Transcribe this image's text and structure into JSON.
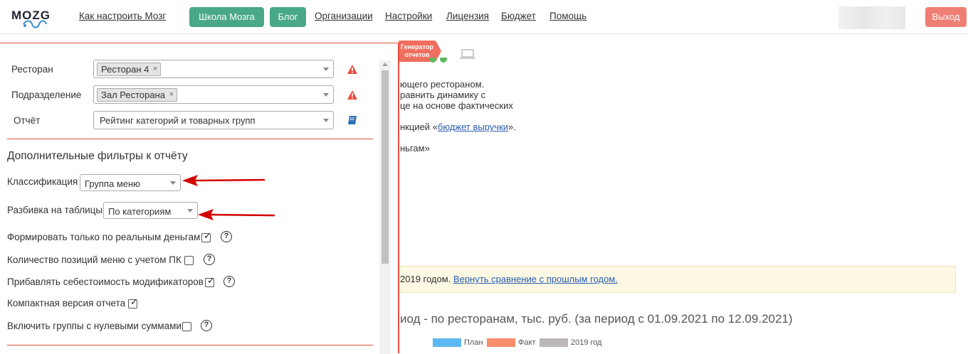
{
  "navbar": {
    "logo": "MOZG",
    "how_to": "Как настроить Мозг",
    "school_button": "Школа Мозга",
    "blog_button": "Блог",
    "links": [
      "Организации",
      "Настройки",
      "Лицензия",
      "Бюджет",
      "Помощь"
    ],
    "logout_button": "Выход"
  },
  "background": {
    "badge": "Генератор отчетов",
    "lines": [
      "ющего ресторaном.",
      "равнить динамику с",
      "це на основе фактических"
    ],
    "budget_prefix": "нкцией «",
    "budget_link": "бюджет выручки",
    "budget_suffix": "».",
    "money_line": "ньгам»",
    "notice_text": "2019 годом. ",
    "notice_link": "Вернуть сравнение с прошлым годом.",
    "chart_title": "иод - по ресторанам, тыс. руб. (за период с 01.09.2021 по 12.09.2021)",
    "legend": [
      {
        "label": "План",
        "color": "#5cb8f0"
      },
      {
        "label": "Факт",
        "color": "#f98e6a"
      },
      {
        "label": "2019 год",
        "color": "#bdb8b8"
      }
    ]
  },
  "panel": {
    "restaurant_label": "Ресторан",
    "restaurant_tag": "Ресторан 4",
    "division_label": "Подразделение",
    "division_tag": "Зал Ресторана",
    "report_label": "Отчёт",
    "report_value": "Рейтинг категорий и товарных групп",
    "section_title": "Дополнительные фильтры к отчёту",
    "classification_label": "Классификация",
    "classification_value": "Группа меню",
    "split_label": "Разбивка на таблицы",
    "split_value": "По категориям",
    "checks": [
      {
        "label": "Формировать только по реальным деньгам",
        "checked": true,
        "help": true
      },
      {
        "label": "Количество позиций меню с учетом ПК",
        "checked": false,
        "help": true
      },
      {
        "label": "Прибавлять себестоимость модификаторов",
        "checked": true,
        "help": true
      },
      {
        "label": "Компактная версия отчета",
        "checked": true,
        "help": false
      },
      {
        "label": "Включить группы с нулевыми суммами",
        "checked": false,
        "help": true
      }
    ],
    "tag_remove": "×",
    "check_mark": "✓",
    "help_mark": "?"
  },
  "colors": {
    "accent_green": "#4aa88a",
    "logout_red": "#ef7f74",
    "panel_border": "#e84c3d",
    "arrow_red": "#d40000"
  }
}
